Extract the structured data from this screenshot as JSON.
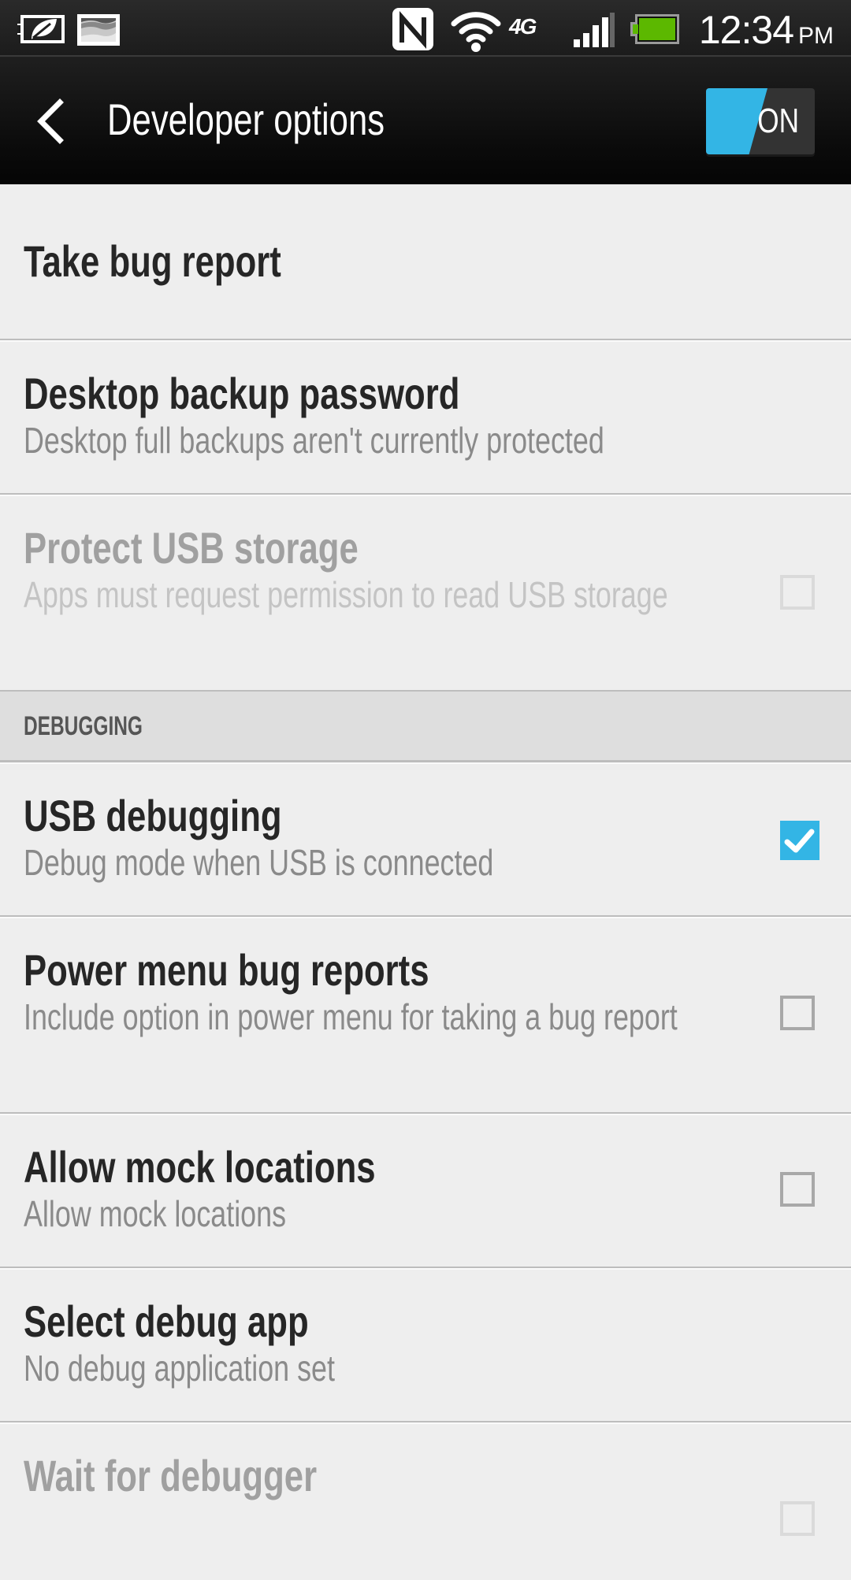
{
  "status_bar": {
    "left_icons": [
      "power-saver-leaf-icon",
      "gallery-image-icon"
    ],
    "right_icons": [
      "nfc-icon",
      "wifi-icon",
      "network-4g-icon",
      "signal-strength-icon",
      "battery-icon"
    ],
    "network_type": "4G",
    "time": "12:34",
    "ampm": "PM",
    "battery_color": "#5cb800"
  },
  "action_bar": {
    "back_icon": "chevron-left-icon",
    "title": "Developer options",
    "master_toggle": {
      "label": "ON",
      "state": true,
      "accent": "#33b5e5"
    }
  },
  "settings": {
    "items": [
      {
        "title": "Take bug report",
        "summary": null,
        "enabled": true,
        "checkbox": null
      },
      {
        "title": "Desktop backup password",
        "summary": "Desktop full backups aren't currently protected",
        "enabled": true,
        "checkbox": null
      },
      {
        "title": "Protect USB storage",
        "summary": "Apps must request permission to read USB storage",
        "enabled": false,
        "checkbox": false
      }
    ],
    "section_debugging": "DEBUGGING",
    "debugging_items": [
      {
        "title": "USB debugging",
        "summary": "Debug mode when USB is connected",
        "enabled": true,
        "checkbox": true
      },
      {
        "title": "Power menu bug reports",
        "summary": "Include option in power menu for taking a bug report",
        "enabled": true,
        "checkbox": false
      },
      {
        "title": "Allow mock locations",
        "summary": "Allow mock locations",
        "enabled": true,
        "checkbox": false
      },
      {
        "title": "Select debug app",
        "summary": "No debug application set",
        "enabled": true,
        "checkbox": null
      },
      {
        "title": "Wait for debugger",
        "summary": null,
        "enabled": false,
        "checkbox": false
      }
    ]
  }
}
